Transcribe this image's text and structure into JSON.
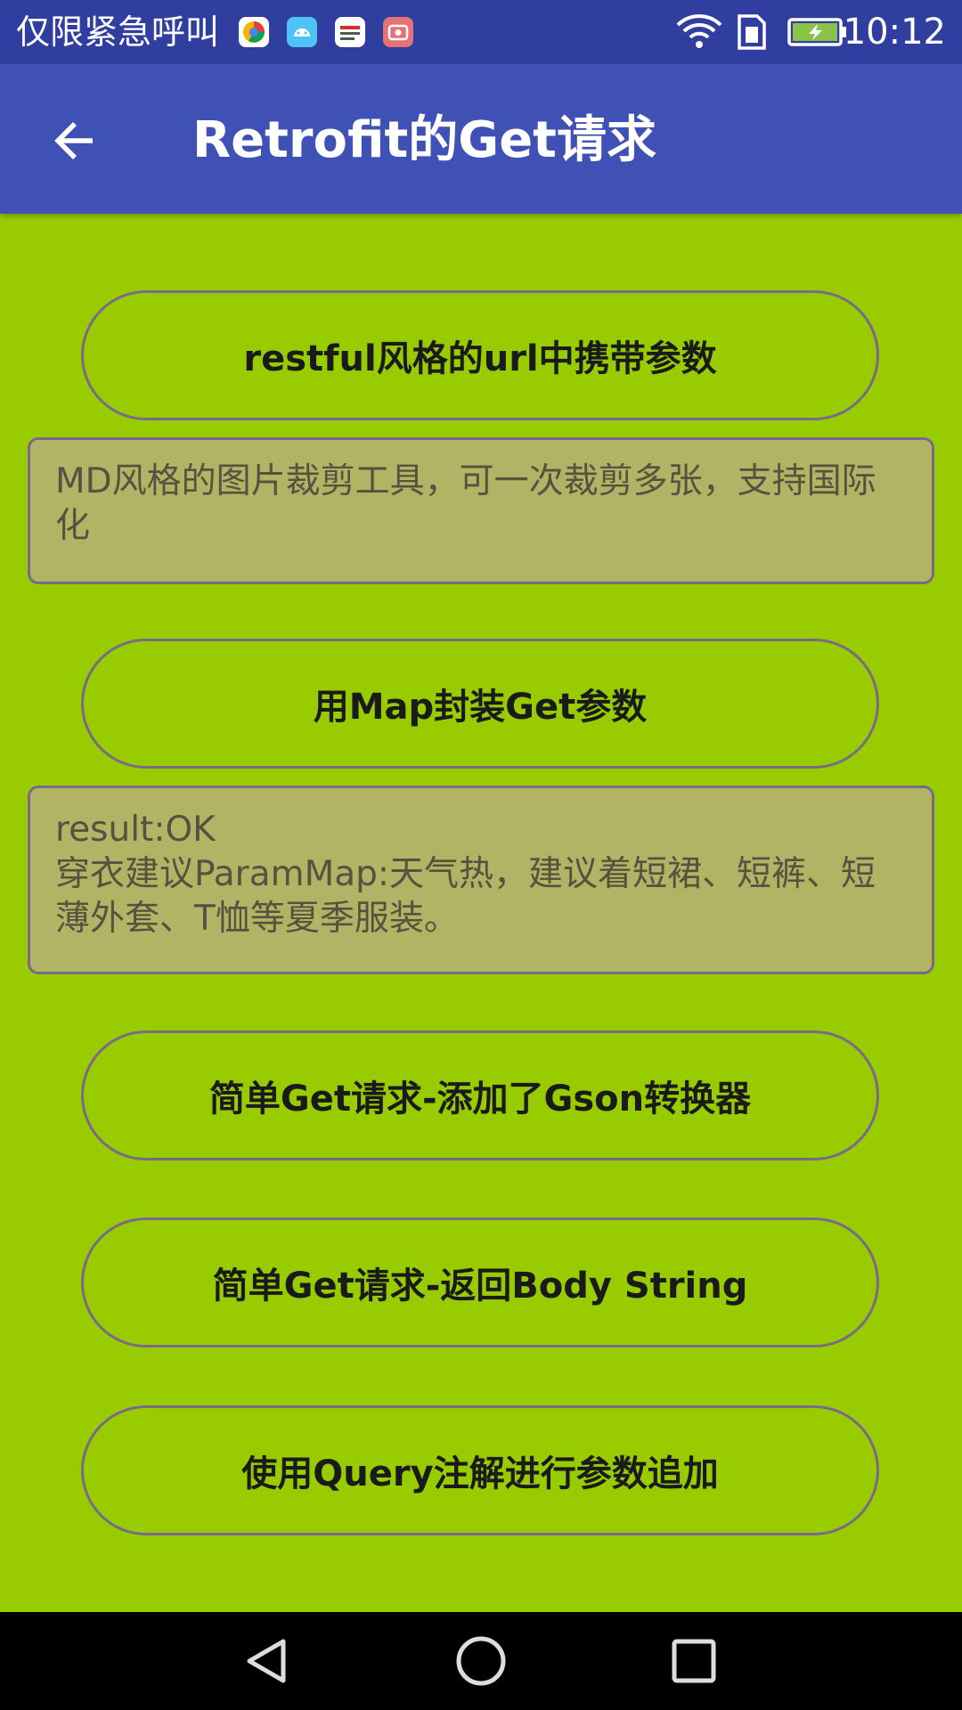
{
  "status_bar": {
    "carrier": "仅限紧急呼叫",
    "time": "10:12",
    "app_icons": [
      "app-icon-browser",
      "app-icon-android",
      "app-icon-news",
      "app-icon-recorder"
    ],
    "right_icons": [
      "wifi-icon",
      "sim-icon",
      "battery-charging-icon"
    ],
    "colors": {
      "background": "#303f9f"
    }
  },
  "app_bar": {
    "title": "Retrofit的Get请求",
    "back_icon": "arrow-left-icon",
    "colors": {
      "background": "#3f51b5"
    }
  },
  "main": {
    "background": "#99cc00",
    "button_restful": "restful风格的url中携带参数",
    "result_1": "MD风格的图片裁剪工具，可一次裁剪多张，支持国际化",
    "button_map": "用Map封装Get参数",
    "result_2": "result:OK\n穿衣建议ParamMap:天气热，建议着短裙、短裤、短薄外套、T恤等夏季服装。",
    "button_gson": "简单Get请求-添加了Gson转换器",
    "button_body_string": "简单Get请求-返回Body String",
    "button_query": "使用Query注解进行参数追加"
  },
  "nav_bar": {
    "icons": [
      "back-triangle-icon",
      "home-circle-icon",
      "recents-square-icon"
    ]
  }
}
